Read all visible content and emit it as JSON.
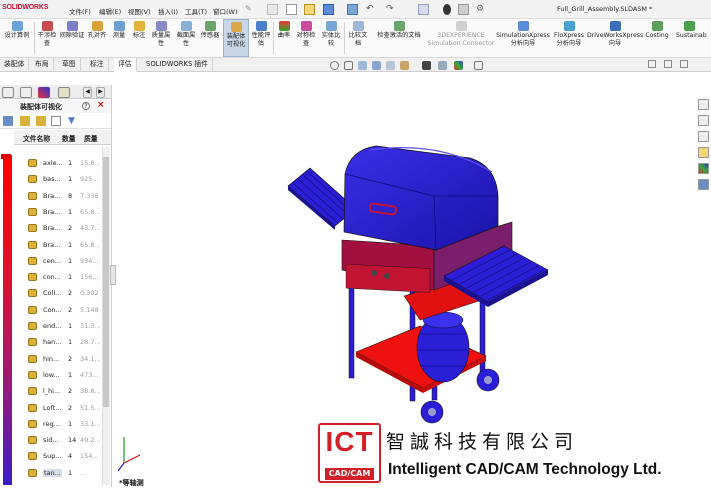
{
  "app": {
    "logo_text": "SOLIDWORKS",
    "document_title": "Full_Grill_Assembly.SLDASM *"
  },
  "menu": [
    {
      "label": "文件(F)"
    },
    {
      "label": "编辑(E)"
    },
    {
      "label": "视图(V)"
    },
    {
      "label": "插入(I)"
    },
    {
      "label": "工具(T)"
    },
    {
      "label": "窗口(W)"
    }
  ],
  "ribbon": [
    {
      "label": "设计算例",
      "icon": "design-study-icon"
    },
    {
      "label": "干涉检查",
      "icon": "interference-icon"
    },
    {
      "label": "间隙验证",
      "icon": "clearance-icon"
    },
    {
      "label": "孔对齐",
      "icon": "hole-align-icon"
    },
    {
      "label": "测量",
      "icon": "measure-icon"
    },
    {
      "label": "标注",
      "icon": "markup-icon"
    },
    {
      "label": "质量属性",
      "icon": "mass-props-icon"
    },
    {
      "label": "截面属性",
      "icon": "section-props-icon"
    },
    {
      "label": "传感器",
      "icon": "sensor-icon"
    },
    {
      "label": "装配体可视化",
      "icon": "assembly-viz-icon"
    },
    {
      "label": "性能评估",
      "icon": "performance-icon"
    },
    {
      "label": "曲率",
      "icon": "curvature-icon"
    },
    {
      "label": "对称检查",
      "icon": "symmetry-icon"
    },
    {
      "label": "实体比较",
      "icon": "compare-icon"
    },
    {
      "label": "比较文档",
      "icon": "compare-doc-icon"
    },
    {
      "label": "检查激活的文档",
      "icon": "check-doc-icon"
    },
    {
      "label": "3DEXPERIENCE Simulation Connector",
      "icon": "3dx-icon"
    },
    {
      "label": "SimulationXpress 分析向导",
      "icon": "simxpress-icon"
    },
    {
      "label": "FloXpress 分析向导",
      "icon": "floxpress-icon"
    },
    {
      "label": "DriveWorksXpress 向导",
      "icon": "driveworks-icon"
    },
    {
      "label": "Costing",
      "icon": "costing-icon"
    },
    {
      "label": "Sustainab",
      "icon": "sustainability-icon"
    }
  ],
  "tabs": [
    "装配体",
    "布局",
    "草图",
    "标注",
    "评估",
    "SOLIDWORKS 插件"
  ],
  "active_tab": "评估",
  "panel": {
    "title": "装配体可视化",
    "columns": [
      "文件名称",
      "数量",
      "质量"
    ],
    "rows": [
      {
        "name": "axle...",
        "qty": "1",
        "mass": "15.6..."
      },
      {
        "name": "bas...",
        "qty": "1",
        "mass": "925..."
      },
      {
        "name": "Bra...",
        "qty": "8",
        "mass": "7.336"
      },
      {
        "name": "Bra...",
        "qty": "1",
        "mass": "65.8..."
      },
      {
        "name": "Bra...",
        "qty": "2",
        "mass": "43.7..."
      },
      {
        "name": "Bra...",
        "qty": "1",
        "mass": "65.8..."
      },
      {
        "name": "cen...",
        "qty": "1",
        "mass": "934..."
      },
      {
        "name": "con...",
        "qty": "1",
        "mass": "156..."
      },
      {
        "name": "Coll...",
        "qty": "2",
        "mass": "0.302"
      },
      {
        "name": "Con...",
        "qty": "2",
        "mass": "5.148"
      },
      {
        "name": "end...",
        "qty": "1",
        "mass": "31.3..."
      },
      {
        "name": "han...",
        "qty": "1",
        "mass": "28.7..."
      },
      {
        "name": "hin...",
        "qty": "2",
        "mass": "34.1..."
      },
      {
        "name": "low...",
        "qty": "1",
        "mass": "473..."
      },
      {
        "name": "l_hi...",
        "qty": "2",
        "mass": "38.8..."
      },
      {
        "name": "Loft...",
        "qty": "2",
        "mass": "51.5..."
      },
      {
        "name": "reg...",
        "qty": "1",
        "mass": "33.1..."
      },
      {
        "name": "sid...",
        "qty": "14",
        "mass": "49.2..."
      },
      {
        "name": "Sup...",
        "qty": "4",
        "mass": "154..."
      },
      {
        "name": "tan...",
        "qty": "1",
        "mass": "..."
      }
    ]
  },
  "viewport": {
    "view_label": "*等轴测"
  },
  "watermark": {
    "logo": "ICT",
    "logo_sub": "CAD/CAM",
    "chinese": "智誠科技有限公司",
    "english": "Intelligent CAD/CAM Technology Ltd."
  },
  "colors": {
    "accent": "#c8102e",
    "grill_blue": "#2a1ed6",
    "grill_red": "#e81010"
  }
}
